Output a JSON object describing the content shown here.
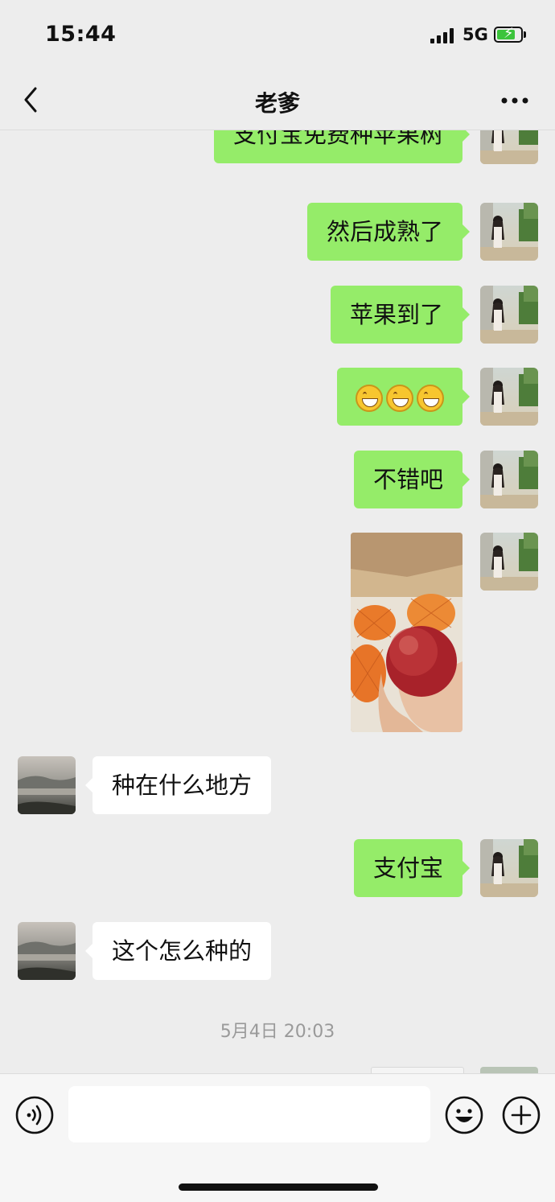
{
  "status_bar": {
    "time": "15:44",
    "network": "5G",
    "battery_percent": 80
  },
  "nav": {
    "title": "老爹"
  },
  "messages": [
    {
      "sender": "me",
      "text": "支付宝免费种苹果树"
    },
    {
      "sender": "me",
      "text": "然后成熟了"
    },
    {
      "sender": "me",
      "text": "苹果到了"
    },
    {
      "sender": "me",
      "type": "emoji",
      "emoji_name": "grin-emoji",
      "count": 3
    },
    {
      "sender": "me",
      "text": "不错吧"
    },
    {
      "sender": "me",
      "type": "image",
      "image_name": "apple-photo"
    },
    {
      "sender": "other",
      "text": "种在什么地方"
    },
    {
      "sender": "me",
      "text": "支付宝"
    },
    {
      "sender": "other",
      "text": "这个怎么种的"
    }
  ],
  "timestamp": "5月4日 20:03",
  "colors": {
    "my_bubble": "#95ec69",
    "other_bubble": "#ffffff",
    "background": "#ededed"
  },
  "icons": [
    "back-arrow-icon",
    "more-icon",
    "voice-icon",
    "emoji-icon",
    "plus-icon"
  ]
}
